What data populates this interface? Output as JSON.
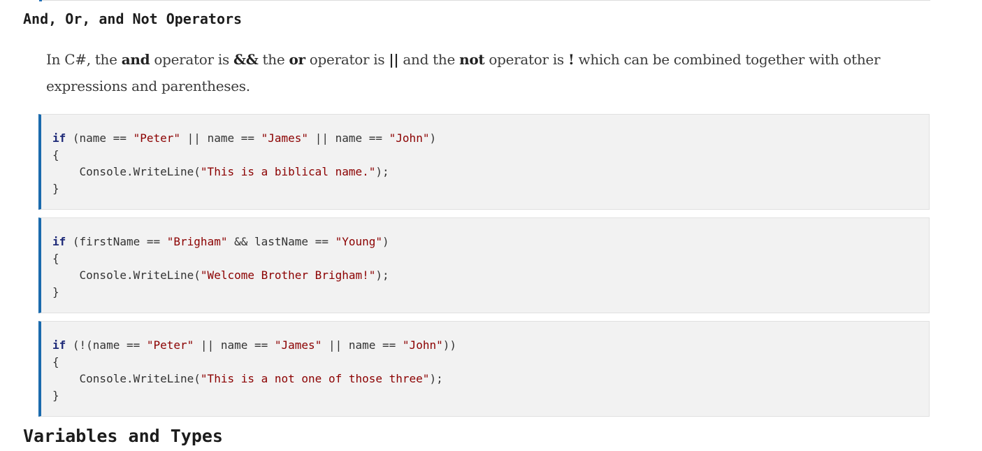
{
  "sections": {
    "operators_heading": "And, Or, and Not Operators",
    "variables_heading": "Variables and Types"
  },
  "paragraph": {
    "t1": "In C#, the ",
    "and_word": "and",
    "t2": " operator is ",
    "and_op": "&&",
    "t3": " the ",
    "or_word": "or",
    "t4": " operator is ",
    "or_op": "||",
    "t5": " and the ",
    "not_word": "not",
    "t6": " operator is ",
    "not_op": "!",
    "t7": " which can be combined together with other expressions and parentheses."
  },
  "code_blocks": [
    {
      "kw": "if",
      "line1_a": " (name == ",
      "s1": "\"Peter\"",
      "line1_b": " || name == ",
      "s2": "\"James\"",
      "line1_c": " || name == ",
      "s3": "\"John\"",
      "line1_d": ")",
      "open": "{",
      "line3_a": "    Console.WriteLine(",
      "s4": "\"This is a biblical name.\"",
      "line3_b": ");",
      "close": "}"
    },
    {
      "kw": "if",
      "line1_a": " (firstName == ",
      "s1": "\"Brigham\"",
      "line1_b": " && lastName == ",
      "s2": "\"Young\"",
      "line1_c": ")",
      "open": "{",
      "line3_a": "    Console.WriteLine(",
      "s3": "\"Welcome Brother Brigham!\"",
      "line3_b": ");",
      "close": "}"
    },
    {
      "kw": "if",
      "line1_a": " (!(name == ",
      "s1": "\"Peter\"",
      "line1_b": " || name == ",
      "s2": "\"James\"",
      "line1_c": " || name == ",
      "s3": "\"John\"",
      "line1_d": "))",
      "open": "{",
      "line3_a": "    Console.WriteLine(",
      "s4": "\"This is a not one of those three\"",
      "line3_b": ");",
      "close": "}"
    }
  ],
  "colors": {
    "accent": "#1a6aad",
    "keyword": "#1e2a78",
    "string": "#8b0000",
    "code_background": "#f2f2f2"
  }
}
